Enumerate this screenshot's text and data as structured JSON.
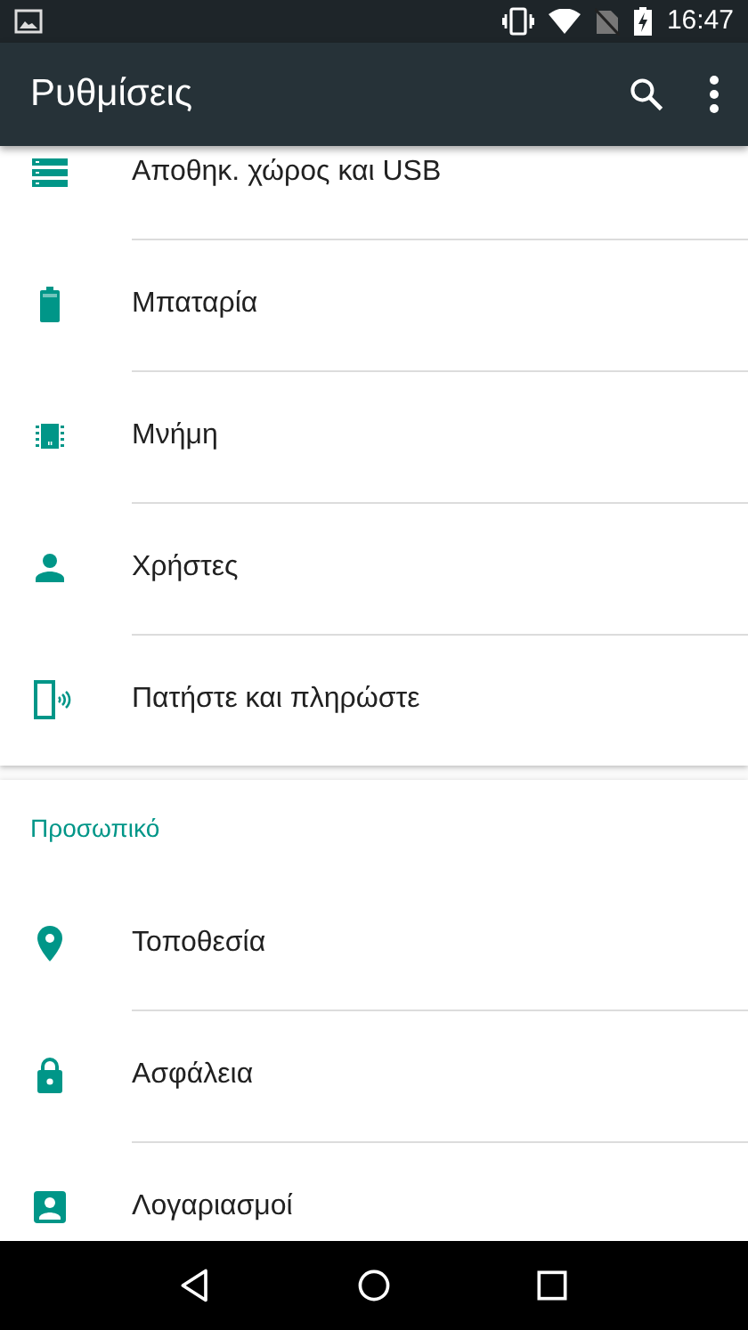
{
  "status_bar": {
    "time": "16:47"
  },
  "app_bar": {
    "title": "Ρυθμίσεις"
  },
  "sections": [
    {
      "items": [
        {
          "kind": "storage",
          "label": "Αποθηκ. χώρος και USB"
        },
        {
          "kind": "battery",
          "label": "Μπαταρία"
        },
        {
          "kind": "memory",
          "label": "Μνήμη"
        },
        {
          "kind": "person",
          "label": "Χρήστες"
        },
        {
          "kind": "tap",
          "label": "Πατήστε και πληρώστε"
        }
      ]
    },
    {
      "header": "Προσωπικό",
      "items": [
        {
          "kind": "location",
          "label": "Τοποθεσία"
        },
        {
          "kind": "lock",
          "label": "Ασφάλεια"
        },
        {
          "kind": "account",
          "label": "Λογαριασμοί"
        }
      ]
    }
  ]
}
